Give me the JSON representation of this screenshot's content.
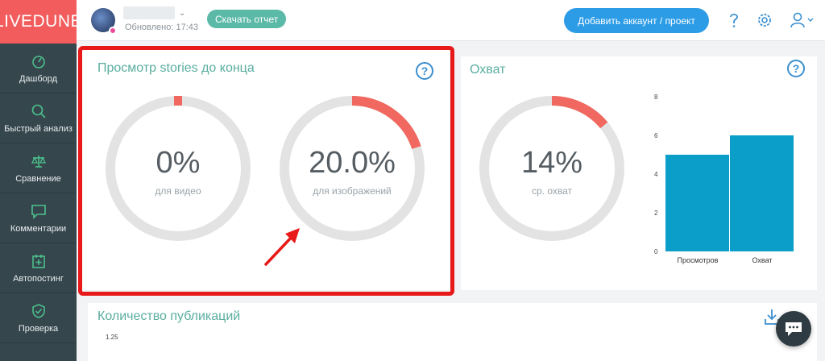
{
  "logo": "LIVEDUNE",
  "nav": [
    {
      "label": "Дашборд",
      "icon": "gauge-icon"
    },
    {
      "label": "Быстрый анализ",
      "icon": "search-icon"
    },
    {
      "label": "Сравнение",
      "icon": "scales-icon"
    },
    {
      "label": "Комментарии",
      "icon": "comment-icon"
    },
    {
      "label": "Автопостинг",
      "icon": "calendar-plus-icon"
    },
    {
      "label": "Проверка",
      "icon": "shield-check-icon"
    }
  ],
  "header": {
    "updated": "Обновлено: 17:43",
    "report_button": "Скачать отчет",
    "add_button": "Добавить аккаунт / проект"
  },
  "stories_card": {
    "title": "Просмотр stories до конца",
    "help": "?",
    "gauges": [
      {
        "value": "0%",
        "caption": "для видео",
        "fraction": 0.0
      },
      {
        "value": "20.0%",
        "caption": "для изображений",
        "fraction": 0.2
      }
    ]
  },
  "reach_card": {
    "title": "Охват",
    "help": "?",
    "gauge": {
      "value": "14%",
      "caption": "ср. охват",
      "fraction": 0.14
    }
  },
  "chart_data": {
    "type": "bar",
    "categories": [
      "Просмотров",
      "Охват"
    ],
    "values": [
      5,
      6
    ],
    "yticks": [
      "0",
      "2",
      "4",
      "6",
      "8"
    ],
    "ylim": [
      0,
      8
    ],
    "color": "#0a9ec9"
  },
  "publications_card": {
    "title": "Количество публикаций",
    "ytick": "1.25"
  },
  "colors": {
    "accent": "#f25c5c",
    "gauge_track": "#e3e3e3",
    "gauge_fill": "#f0685f",
    "bar": "#0a9ec9",
    "title": "#5aaea0"
  }
}
